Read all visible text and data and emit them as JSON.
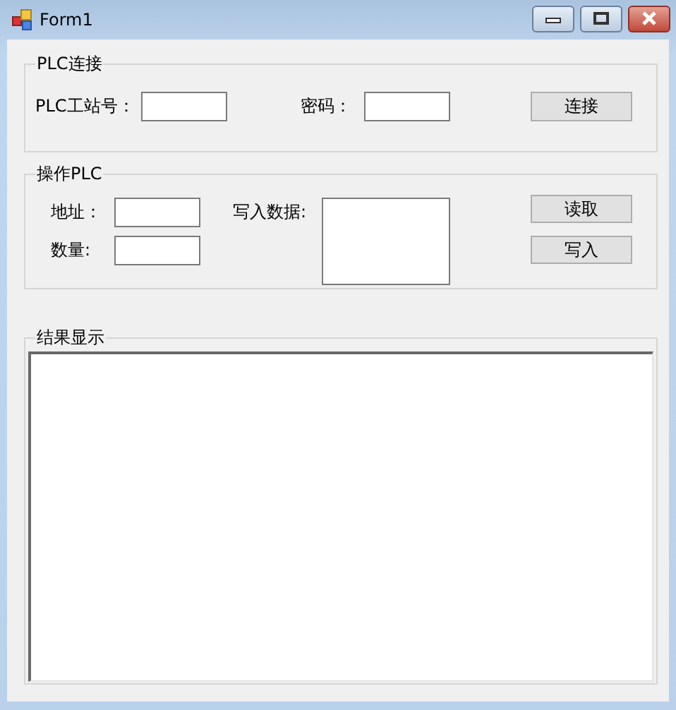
{
  "window": {
    "title": "Form1"
  },
  "groups": [
    {
      "kind": "connection",
      "title": "PLC连接",
      "fields": [
        {
          "label": "PLC工站号："
        },
        {
          "label": "密码："
        }
      ],
      "buttons": [
        "连接"
      ]
    },
    {
      "kind": "operation",
      "title": "操作PLC",
      "fields": [
        {
          "label": "地址："
        },
        {
          "label": "数量:"
        },
        {
          "label": "写入数据:"
        }
      ],
      "buttons": [
        "读取",
        "写入"
      ]
    },
    {
      "kind": "result",
      "title": "结果显示"
    }
  ]
}
